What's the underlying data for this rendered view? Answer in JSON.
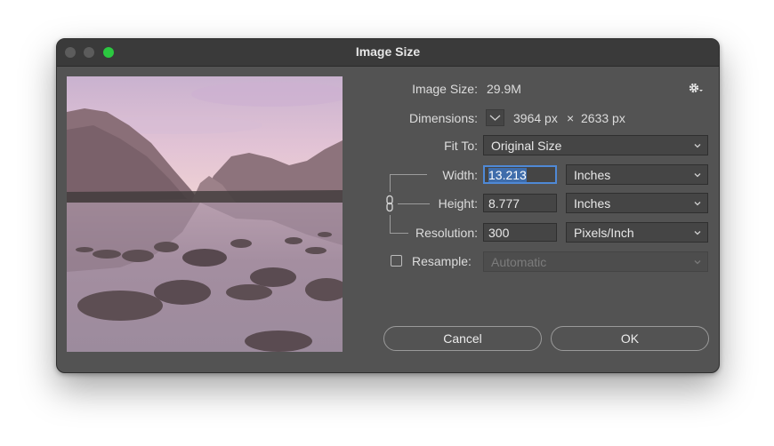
{
  "window": {
    "title": "Image Size"
  },
  "info": {
    "image_size_label": "Image Size:",
    "image_size_value": "29.9M",
    "dimensions_label": "Dimensions:",
    "dimensions_width": "3964 px",
    "dimensions_sep": "×",
    "dimensions_height": "2633 px"
  },
  "fit_to": {
    "label": "Fit To:",
    "value": "Original Size"
  },
  "width": {
    "label": "Width:",
    "value": "13.213",
    "unit": "Inches"
  },
  "height": {
    "label": "Height:",
    "value": "8.777",
    "unit": "Inches"
  },
  "resolution": {
    "label": "Resolution:",
    "value": "300",
    "unit": "Pixels/Inch"
  },
  "resample": {
    "label": "Resample:",
    "checked": false,
    "value": "Automatic"
  },
  "buttons": {
    "cancel": "Cancel",
    "ok": "OK"
  },
  "colors": {
    "accent": "#4f89d6",
    "close_light": "#2bc840"
  },
  "icons": {
    "settings": "gear-icon",
    "link": "chain-link-icon"
  }
}
